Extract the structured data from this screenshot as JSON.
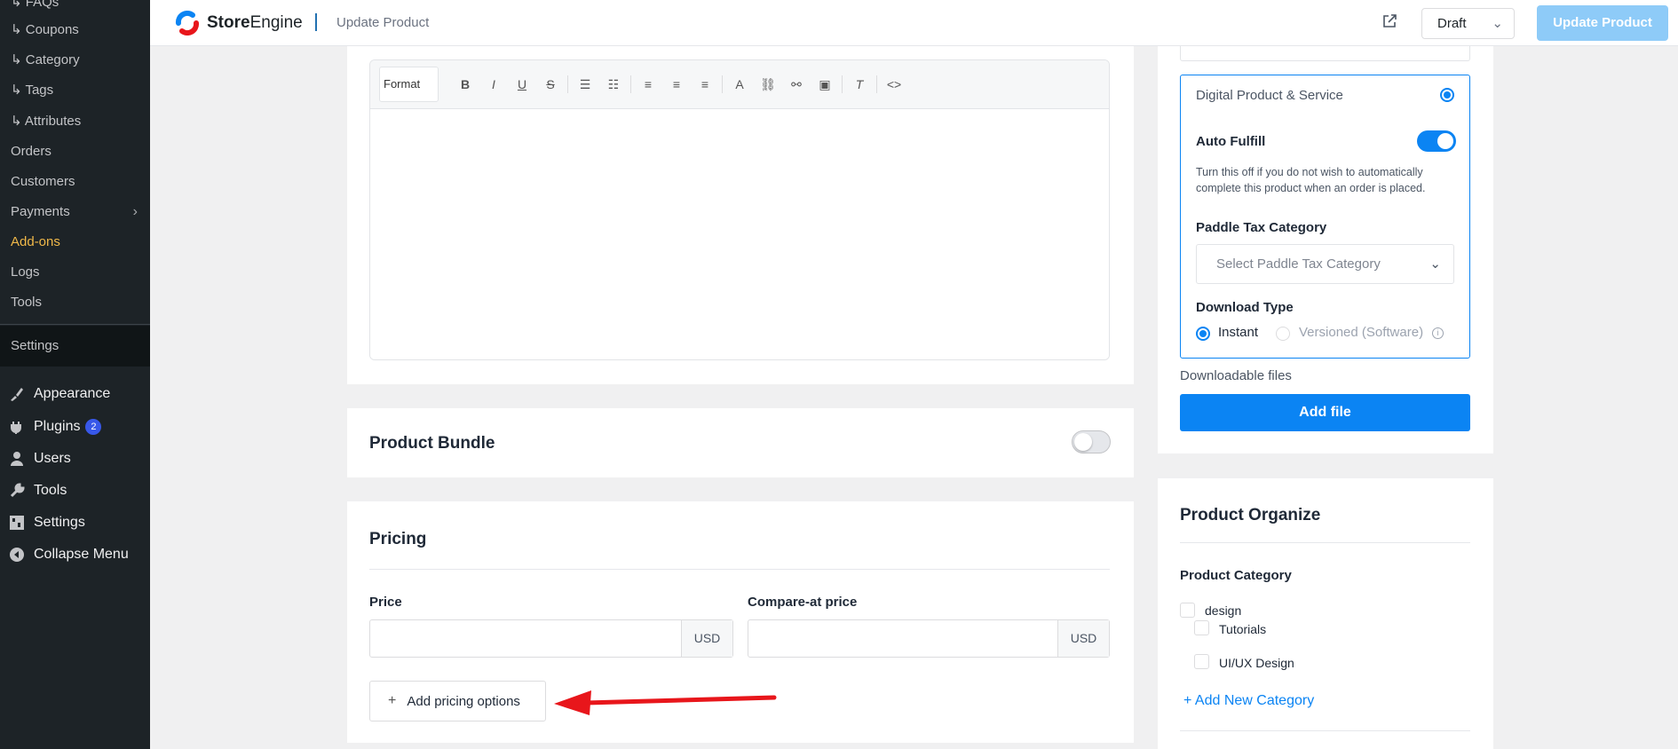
{
  "sidebar": {
    "sub_items": [
      {
        "label": "↳ FAQs"
      },
      {
        "label": "↳ Coupons"
      },
      {
        "label": "↳ Category"
      },
      {
        "label": "↳ Tags"
      },
      {
        "label": "↳ Attributes"
      },
      {
        "label": "Orders"
      },
      {
        "label": "Customers"
      },
      {
        "label": "Payments"
      },
      {
        "label": "Add-ons"
      },
      {
        "label": "Logs"
      },
      {
        "label": "Tools"
      }
    ],
    "settings_label": "Settings",
    "main_items": [
      {
        "label": "Appearance",
        "icon": "brush-icon"
      },
      {
        "label": "Plugins",
        "icon": "plug-icon",
        "badge": "2"
      },
      {
        "label": "Users",
        "icon": "user-icon"
      },
      {
        "label": "Tools",
        "icon": "wrench-icon"
      },
      {
        "label": "Settings",
        "icon": "sliders-icon"
      },
      {
        "label": "Collapse Menu",
        "icon": "collapse-icon"
      }
    ],
    "active_color": "#f0b849"
  },
  "topbar": {
    "logo_bold": "Store",
    "logo_light": "Engine",
    "breadcrumb": "Update Product",
    "status_select": "Draft",
    "update_button": "Update Product"
  },
  "editor": {
    "format_label": "Format"
  },
  "bundle": {
    "title": "Product Bundle",
    "enabled": false
  },
  "pricing": {
    "title": "Pricing",
    "price_label": "Price",
    "price_value": "",
    "price_currency": "USD",
    "compare_label": "Compare-at price",
    "compare_value": "",
    "compare_currency": "USD",
    "add_options_label": "Add pricing options"
  },
  "digital": {
    "title": "Digital Product & Service",
    "selected": true,
    "auto_fulfill_label": "Auto Fulfill",
    "auto_fulfill_enabled": true,
    "auto_fulfill_help": "Turn this off if you do not wish to automatically complete this product when an order is placed.",
    "paddle_label": "Paddle Tax Category",
    "paddle_placeholder": "Select Paddle Tax Category",
    "download_type_label": "Download Type",
    "download_options": [
      "Instant",
      "Versioned (Software)"
    ],
    "download_selected": "Instant"
  },
  "files": {
    "label": "Downloadable files",
    "add_button": "Add file"
  },
  "organize": {
    "title": "Product Organize",
    "category_label": "Product Category",
    "categories": [
      {
        "name": "design"
      },
      {
        "name": "Tutorials"
      },
      {
        "name": "UI/UX Design"
      }
    ],
    "add_category": "Add New Category"
  },
  "colors": {
    "accent": "#0b84f3",
    "annotation_arrow": "#e8161b"
  }
}
